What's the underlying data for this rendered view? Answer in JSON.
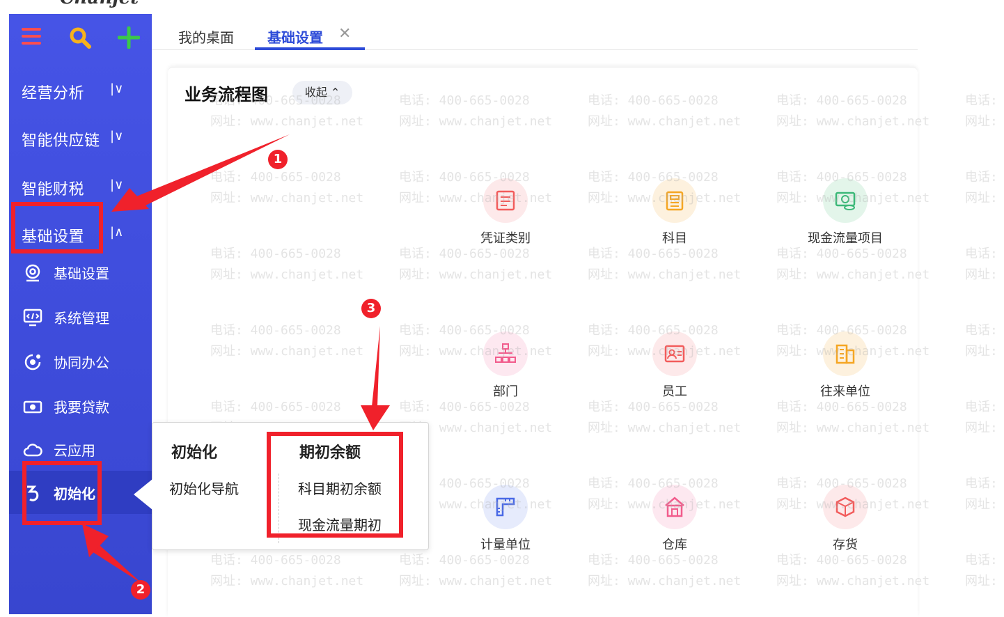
{
  "app": {
    "logo": "Chanjet"
  },
  "watermark": {
    "line1": "电话: 400-665-0028",
    "line2": "网址: www.chanjet.net"
  },
  "sidebar": {
    "toolbar": {
      "menu_icon": "menu-icon",
      "search_icon": "search-icon",
      "add_icon": "plus-icon"
    },
    "groups": [
      {
        "label": "经营分析",
        "chevron": "|∨"
      },
      {
        "label": "智能供应链",
        "chevron": "|∨"
      },
      {
        "label": "智能财税",
        "chevron": "|∨"
      },
      {
        "label": "基础设置",
        "chevron": "|∧"
      }
    ],
    "items": [
      {
        "label": "基础设置",
        "icon": "settings-icon"
      },
      {
        "label": "系统管理",
        "icon": "monitor-icon"
      },
      {
        "label": "协同办公",
        "icon": "cooperation-icon"
      },
      {
        "label": "我要贷款",
        "icon": "loan-icon"
      },
      {
        "label": "云应用",
        "icon": "cloud-icon"
      },
      {
        "label": "初始化",
        "icon": "init-icon"
      }
    ],
    "active_label_shown": "初始化"
  },
  "tabs": [
    {
      "label": "我的桌面"
    },
    {
      "label": "基础设置",
      "active": true,
      "close": "✕"
    }
  ],
  "main": {
    "title": "业务流程图",
    "collapse_label": "收起 ⌃",
    "functions": [
      {
        "label": "凭证类别",
        "icon": "voucher-type-icon",
        "color": "#f25c5c"
      },
      {
        "label": "科目",
        "icon": "account-icon",
        "color": "#f5a623"
      },
      {
        "label": "现金流量项目",
        "icon": "cashflow-icon",
        "color": "#3cb878"
      },
      {
        "label": "部门",
        "icon": "department-icon",
        "color": "#f25c8c"
      },
      {
        "label": "员工",
        "icon": "employee-icon",
        "color": "#f25c5c"
      },
      {
        "label": "往来单位",
        "icon": "partner-icon",
        "color": "#f5a623"
      },
      {
        "label": "计量单位",
        "icon": "unit-icon",
        "color": "#4a6ae6"
      },
      {
        "label": "仓库",
        "icon": "warehouse-icon",
        "color": "#f25c8c"
      },
      {
        "label": "存货",
        "icon": "inventory-icon",
        "color": "#f25c5c"
      }
    ]
  },
  "popup": {
    "col1": {
      "heading": "初始化",
      "items": [
        "初始化导航"
      ]
    },
    "col2": {
      "heading": "期初余额",
      "items": [
        "科目期初余额",
        "现金流量期初"
      ]
    }
  },
  "annotations": {
    "badges": [
      "1",
      "2",
      "3"
    ],
    "color": "#f0212b"
  }
}
